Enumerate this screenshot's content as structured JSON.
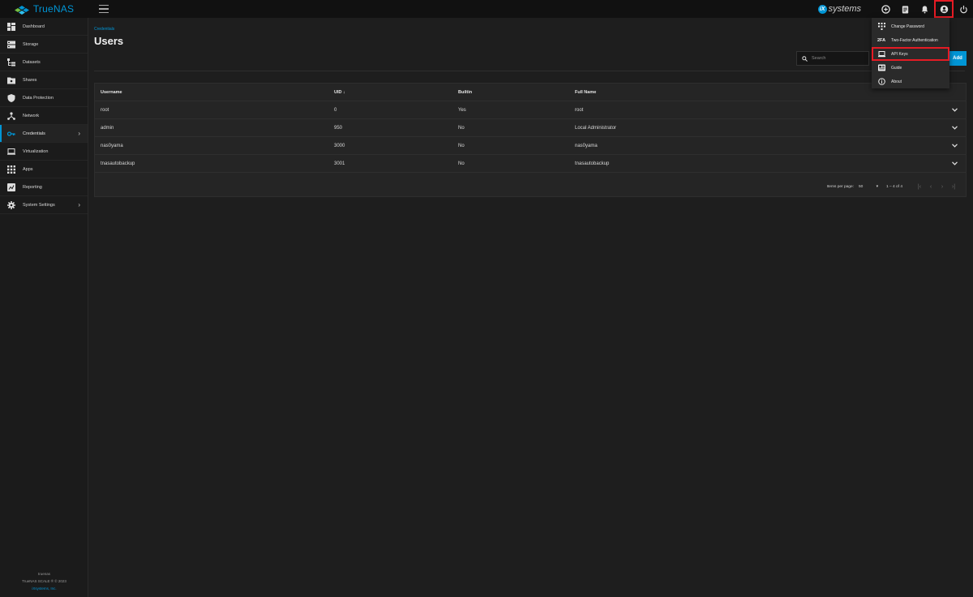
{
  "topbar": {
    "logo_text": "TrueNAS",
    "ix_mark": "iX",
    "ix_text": "systems",
    "icons": [
      "truecommand-icon",
      "clipboard-icon",
      "bell-icon",
      "account-icon",
      "power-icon"
    ]
  },
  "sidebar": {
    "items": [
      {
        "label": "Dashboard",
        "icon": "dashboard-icon"
      },
      {
        "label": "Storage",
        "icon": "storage-icon"
      },
      {
        "label": "Datasets",
        "icon": "datasets-icon"
      },
      {
        "label": "Shares",
        "icon": "shares-icon"
      },
      {
        "label": "Data Protection",
        "icon": "shield-icon"
      },
      {
        "label": "Network",
        "icon": "network-icon"
      },
      {
        "label": "Credentials",
        "icon": "key-icon",
        "active": true
      },
      {
        "label": "Virtualization",
        "icon": "laptop-icon"
      },
      {
        "label": "Apps",
        "icon": "apps-icon"
      },
      {
        "label": "Reporting",
        "icon": "chart-icon"
      },
      {
        "label": "System Settings",
        "icon": "gear-icon"
      }
    ],
    "footer": {
      "hostname": "truenas",
      "version": "TrueNAS SCALE ® © 2023",
      "company": "iXsystems, Inc."
    }
  },
  "main": {
    "breadcrumb": "Credentials",
    "title": "Users",
    "search_placeholder": "Search",
    "add_label": "Add",
    "table": {
      "headers": [
        "Username",
        "UID",
        "Builtin",
        "Full Name"
      ],
      "sort_indicator": "↓",
      "rows": [
        [
          "root",
          "0",
          "Yes",
          "root"
        ],
        [
          "admin",
          "950",
          "No",
          "Local Administrator"
        ],
        [
          "nas0yama",
          "3000",
          "No",
          "nas0yama"
        ],
        [
          "tnasautobackup",
          "3001",
          "No",
          "tnasautobackup"
        ]
      ]
    },
    "paginator": {
      "items_label": "Items per page:",
      "page_size": "50",
      "range": "1 – 4 of 4"
    }
  },
  "user_menu": {
    "items": [
      {
        "label": "Change Password",
        "icon": "dialpad-icon"
      },
      {
        "label": "Two-Factor Authentication",
        "icon": "2fa-icon",
        "icon_text": "2FA"
      },
      {
        "label": "API Keys",
        "icon": "laptop-icon",
        "highlight": true
      },
      {
        "label": "Guide",
        "icon": "guide-icon"
      },
      {
        "label": "About",
        "icon": "info-icon"
      }
    ]
  },
  "colors": {
    "accent": "#0095d5",
    "highlight": "#e51b24",
    "background": "#1e1e1e",
    "topbar": "#111111"
  }
}
